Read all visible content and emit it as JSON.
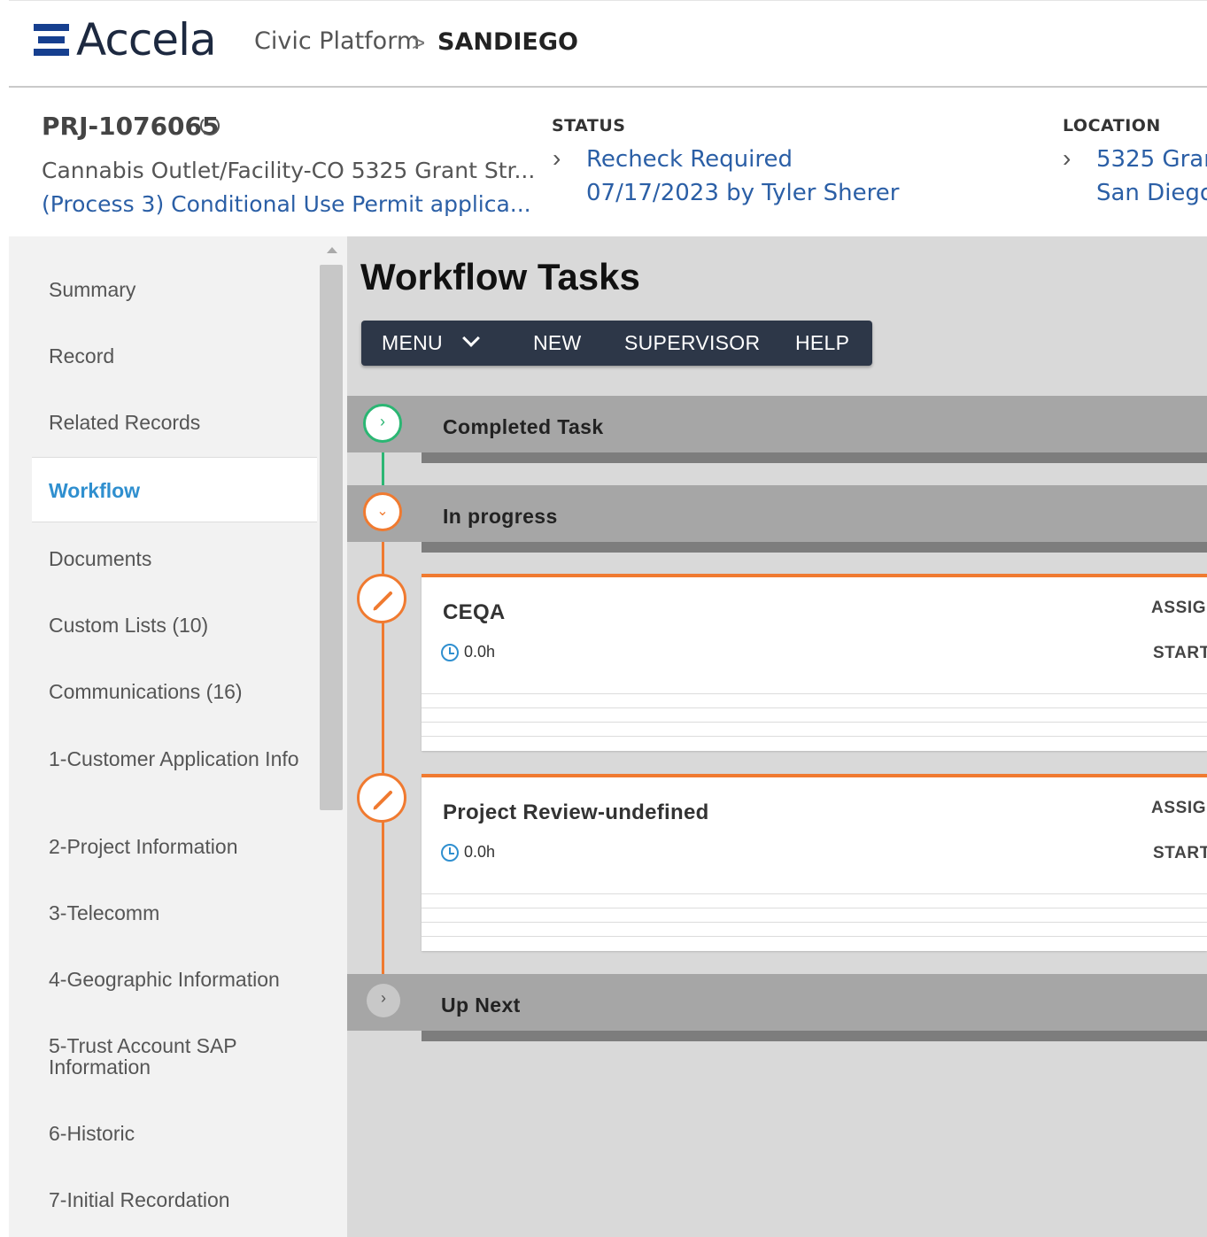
{
  "header": {
    "logo_text": "Accela",
    "breadcrumb_product": "Civic Platform",
    "breadcrumb_sep": ">",
    "breadcrumb_agency": "SANDIEGO"
  },
  "record": {
    "id": "PRJ-1076065",
    "desc_line1": "Cannabis Outlet/Facility-CO 5325 Grant Str...",
    "desc_line2": "(Process 3) Conditional Use Permit applica...",
    "status_label": "STATUS",
    "status_value": "Recheck Required",
    "status_date": "07/17/2023 by Tyler Sherer",
    "location_label": "LOCATION",
    "location_line1": "5325 Gran",
    "location_line2": "San Diego,"
  },
  "sidebar": {
    "items": [
      {
        "label": "Summary"
      },
      {
        "label": "Record"
      },
      {
        "label": "Related Records"
      },
      {
        "label": "Workflow"
      },
      {
        "label": "Documents"
      },
      {
        "label": "Custom Lists (10)"
      },
      {
        "label": "Communications (16)"
      },
      {
        "label": "1-Customer Application Info"
      },
      {
        "label": "2-Project Information"
      },
      {
        "label": "3-Telecomm"
      },
      {
        "label": "4-Geographic Information"
      },
      {
        "label": "5-Trust Account SAP Information"
      },
      {
        "label": "6-Historic"
      },
      {
        "label": "7-Initial Recordation"
      }
    ],
    "active": "Workflow"
  },
  "main": {
    "title": "Workflow Tasks",
    "toolbar": {
      "menu": "MENU",
      "new": "NEW",
      "supervisor": "SUPERVISOR",
      "help": "HELP"
    },
    "sections": {
      "completed": "Completed Task",
      "in_progress": "In progress",
      "up_next": "Up Next"
    },
    "tasks": [
      {
        "name": "CEQA",
        "time": "0.0h",
        "assigned_label": "ASSIG",
        "start_label": "START"
      },
      {
        "name": "Project Review-undefined",
        "time": "0.0h",
        "assigned_label": "ASSIG",
        "start_label": "START"
      }
    ]
  },
  "colors": {
    "accent_blue": "#2f8fcf",
    "link_blue": "#2b5fa6",
    "toolbar_bg": "#2d3748",
    "completed_green": "#2bb673",
    "in_progress_orange": "#f07a30"
  },
  "icons": [
    "refresh-icon",
    "chevron-right-icon",
    "chevron-down-icon",
    "pencil-icon",
    "clock-icon"
  ]
}
